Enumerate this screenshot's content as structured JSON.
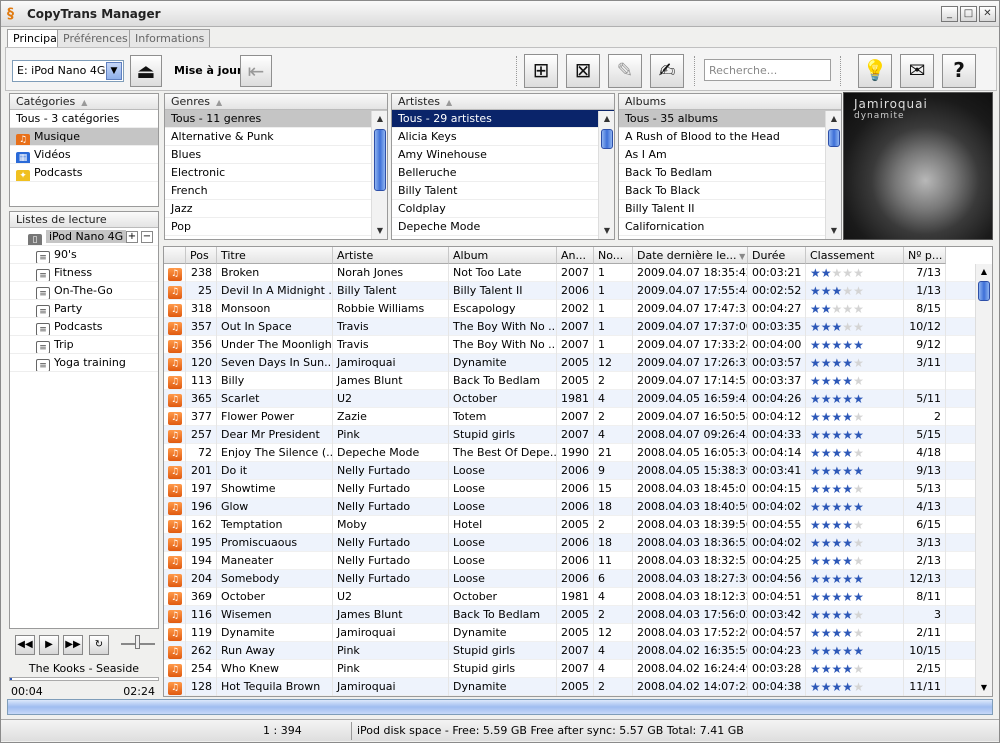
{
  "app": {
    "title": "CopyTrans Manager"
  },
  "tabs": [
    "Principal",
    "Préférences",
    "Informations"
  ],
  "toolbar": {
    "device": "E: iPod Nano 4G",
    "update_label": "Mise à jour",
    "search_placeholder": "Recherche..."
  },
  "categories": {
    "header": "Catégories",
    "items": [
      "Tous - 3 catégories",
      "Musique",
      "Vidéos",
      "Podcasts"
    ]
  },
  "playlists": {
    "header": "Listes de lecture",
    "device": "iPod Nano 4G",
    "items": [
      "90's",
      "Fitness",
      "On-The-Go",
      "Party",
      "Podcasts",
      "Trip",
      "Yoga training"
    ]
  },
  "genres": {
    "header": "Genres",
    "items": [
      "Tous - 11 genres",
      "Alternative & Punk",
      "Blues",
      "Electronic",
      "French",
      "Jazz",
      "Pop"
    ]
  },
  "artists": {
    "header": "Artistes",
    "items": [
      "Tous - 29 artistes",
      "Alicia Keys",
      "Amy Winehouse",
      "Belleruche",
      "Billy Talent",
      "Coldplay",
      "Depeche Mode"
    ]
  },
  "albums": {
    "header": "Albums",
    "items": [
      "Tous - 35 albums",
      "A Rush of Blood to the Head",
      "As I Am",
      "Back To Bedlam",
      "Back To Black",
      "Billy Talent II",
      "Californication"
    ]
  },
  "cover": {
    "line1": "Jamiroquai",
    "line2": "dynamite"
  },
  "table": {
    "columns": [
      "Pos",
      "Titre",
      "Artiste",
      "Album",
      "An...",
      "No...",
      "Date dernière le...",
      "Durée",
      "Classement",
      "Nº p..."
    ],
    "rows": [
      [
        "238",
        "Broken",
        "Norah Jones",
        "Not Too Late",
        "2007",
        "1",
        "2009.04.07 18:35:42",
        "00:03:21",
        2,
        "7/13"
      ],
      [
        "25",
        "Devil In A Midnight ...",
        "Billy Talent",
        "Billy Talent II",
        "2006",
        "1",
        "2009.04.07 17:55:44",
        "00:02:52",
        3,
        "1/13"
      ],
      [
        "318",
        "Monsoon",
        "Robbie Williams",
        "Escapology",
        "2002",
        "1",
        "2009.04.07 17:47:35",
        "00:04:27",
        2,
        "8/15"
      ],
      [
        "357",
        "Out In Space",
        "Travis",
        "The Boy With No ...",
        "2007",
        "1",
        "2009.04.07 17:37:00",
        "00:03:35",
        3,
        "10/12"
      ],
      [
        "356",
        "Under The Moonlight",
        "Travis",
        "The Boy With No ...",
        "2007",
        "1",
        "2009.04.07 17:33:24",
        "00:04:00",
        5,
        "9/12"
      ],
      [
        "120",
        "Seven Days In Sun...",
        "Jamiroquai",
        "Dynamite",
        "2005",
        "12",
        "2009.04.07 17:26:32",
        "00:03:57",
        4,
        "3/11"
      ],
      [
        "113",
        "Billy",
        "James Blunt",
        "Back To Bedlam",
        "2005",
        "2",
        "2009.04.07 17:14:53",
        "00:03:37",
        4,
        ""
      ],
      [
        "365",
        "Scarlet",
        "U2",
        "October",
        "1981",
        "4",
        "2009.04.05 16:59:45",
        "00:04:26",
        5,
        "5/11"
      ],
      [
        "377",
        "Flower Power",
        "Zazie",
        "Totem",
        "2007",
        "2",
        "2009.04.07 16:50:58",
        "00:04:12",
        4,
        "2"
      ],
      [
        "257",
        "Dear Mr President",
        "Pink",
        "Stupid girls",
        "2007",
        "4",
        "2008.04.07 09:26:45",
        "00:04:33",
        5,
        "5/15"
      ],
      [
        "72",
        "Enjoy The Silence (...",
        "Depeche Mode",
        "The Best Of Depe...",
        "1990",
        "21",
        "2008.04.05 16:05:34",
        "00:04:14",
        4,
        "4/18"
      ],
      [
        "201",
        "Do it",
        "Nelly Furtado",
        "Loose",
        "2006",
        "9",
        "2008.04.05 15:38:39",
        "00:03:41",
        5,
        "9/13"
      ],
      [
        "197",
        "Showtime",
        "Nelly Furtado",
        "Loose",
        "2006",
        "15",
        "2008.04.03 18:45:01",
        "00:04:15",
        4,
        "5/13"
      ],
      [
        "196",
        "Glow",
        "Nelly Furtado",
        "Loose",
        "2006",
        "18",
        "2008.04.03 18:40:50",
        "00:04:02",
        5,
        "4/13"
      ],
      [
        "162",
        "Temptation",
        "Moby",
        "Hotel",
        "2005",
        "2",
        "2008.04.03 18:39:56",
        "00:04:55",
        4,
        "6/15"
      ],
      [
        "195",
        "Promiscuaous",
        "Nelly Furtado",
        "Loose",
        "2006",
        "18",
        "2008.04.03 18:36:52",
        "00:04:02",
        4,
        "3/13"
      ],
      [
        "194",
        "Maneater",
        "Nelly Furtado",
        "Loose",
        "2006",
        "11",
        "2008.04.03 18:32:55",
        "00:04:25",
        4,
        "2/13"
      ],
      [
        "204",
        "Somebody",
        "Nelly Furtado",
        "Loose",
        "2006",
        "6",
        "2008.04.03 18:27:30",
        "00:04:56",
        5,
        "12/13"
      ],
      [
        "369",
        "October",
        "U2",
        "October",
        "1981",
        "4",
        "2008.04.03 18:12:32",
        "00:04:51",
        5,
        "8/11"
      ],
      [
        "116",
        "Wisemen",
        "James Blunt",
        "Back To Bedlam",
        "2005",
        "2",
        "2008.04.03 17:56:02",
        "00:03:42",
        4,
        "3"
      ],
      [
        "119",
        "Dynamite",
        "Jamiroquai",
        "Dynamite",
        "2005",
        "12",
        "2008.04.03 17:52:20",
        "00:04:57",
        4,
        "2/11"
      ],
      [
        "262",
        "Run Away",
        "Pink",
        "Stupid girls",
        "2007",
        "4",
        "2008.04.02 16:35:56",
        "00:04:23",
        5,
        "10/15"
      ],
      [
        "254",
        "Who Knew",
        "Pink",
        "Stupid girls",
        "2007",
        "4",
        "2008.04.02 16:24:49",
        "00:03:28",
        4,
        "2/15"
      ],
      [
        "128",
        "Hot Tequila Brown",
        "Jamiroquai",
        "Dynamite",
        "2005",
        "2",
        "2008.04.02 14:07:28",
        "00:04:38",
        4,
        "11/11"
      ]
    ]
  },
  "player": {
    "now_playing": "The Kooks - Seaside",
    "elapsed": "00:04",
    "total": "02:24"
  },
  "status": {
    "count": "1 : 394",
    "disk": "iPod disk space - Free: 5.59 GB Free after sync: 5.57 GB Total: 7.41 GB"
  }
}
